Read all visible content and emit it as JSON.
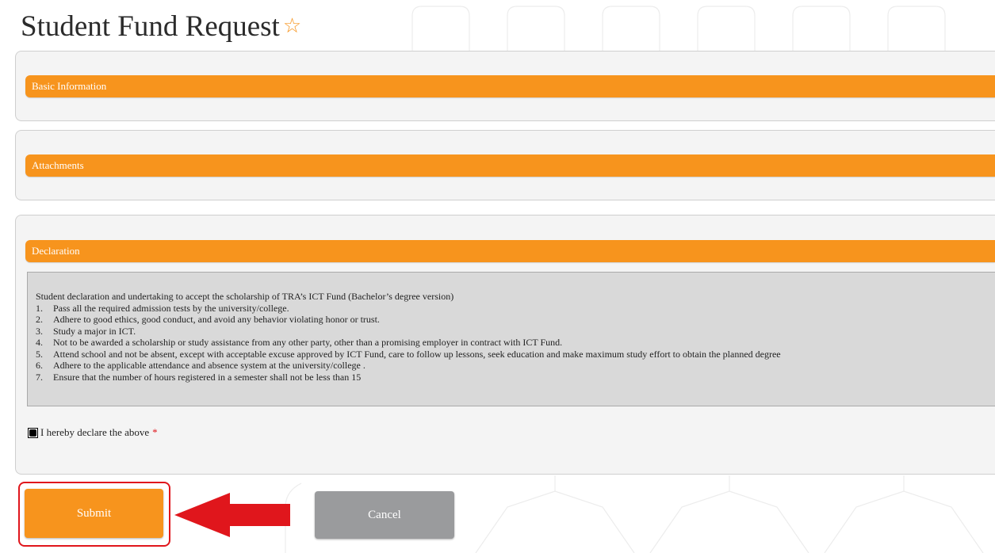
{
  "page": {
    "title": "Student Fund Request",
    "favorite_icon": "star-outline-icon"
  },
  "sections": {
    "basic": {
      "label": "Basic Information"
    },
    "attachments": {
      "label": "Attachments"
    },
    "declaration": {
      "label": "Declaration",
      "intro": "Student declaration and undertaking  to accept the scholarship of TRA’s ICT Fund (Bachelor’s degree version)",
      "items": [
        {
          "num": "1.",
          "text": "Pass all the required admission tests by the university/college."
        },
        {
          "num": "2.",
          "text": "Adhere to good ethics, good conduct, and avoid any behavior violating honor or trust."
        },
        {
          "num": "3.",
          "text": "Study a major in ICT."
        },
        {
          "num": "4.",
          "text": "Not to be awarded a scholarship or study assistance from any other party, other than a promising employer in contract with ICT Fund."
        },
        {
          "num": "5.",
          "text": "Attend school and not be absent, except with acceptable excuse approved by ICT Fund, care to follow up lessons, seek education and make maximum study effort to obtain the planned degree"
        },
        {
          "num": "6.",
          "text": "Adhere to the applicable attendance and absence system at the university/college ."
        },
        {
          "num": "7.",
          "text": "Ensure that the number of  hours registered in a semester shall not be less than 15"
        }
      ],
      "checkbox_label": "I hereby declare the above",
      "required_mark": "*",
      "checked": true
    }
  },
  "actions": {
    "submit_label": "Submit",
    "cancel_label": "Cancel"
  },
  "colors": {
    "accent": "#f7941d",
    "cancel": "#9a9b9d",
    "highlight": "#e0161c",
    "panel_bg": "#f4f4f4",
    "declaration_bg": "#d9d9d9"
  }
}
